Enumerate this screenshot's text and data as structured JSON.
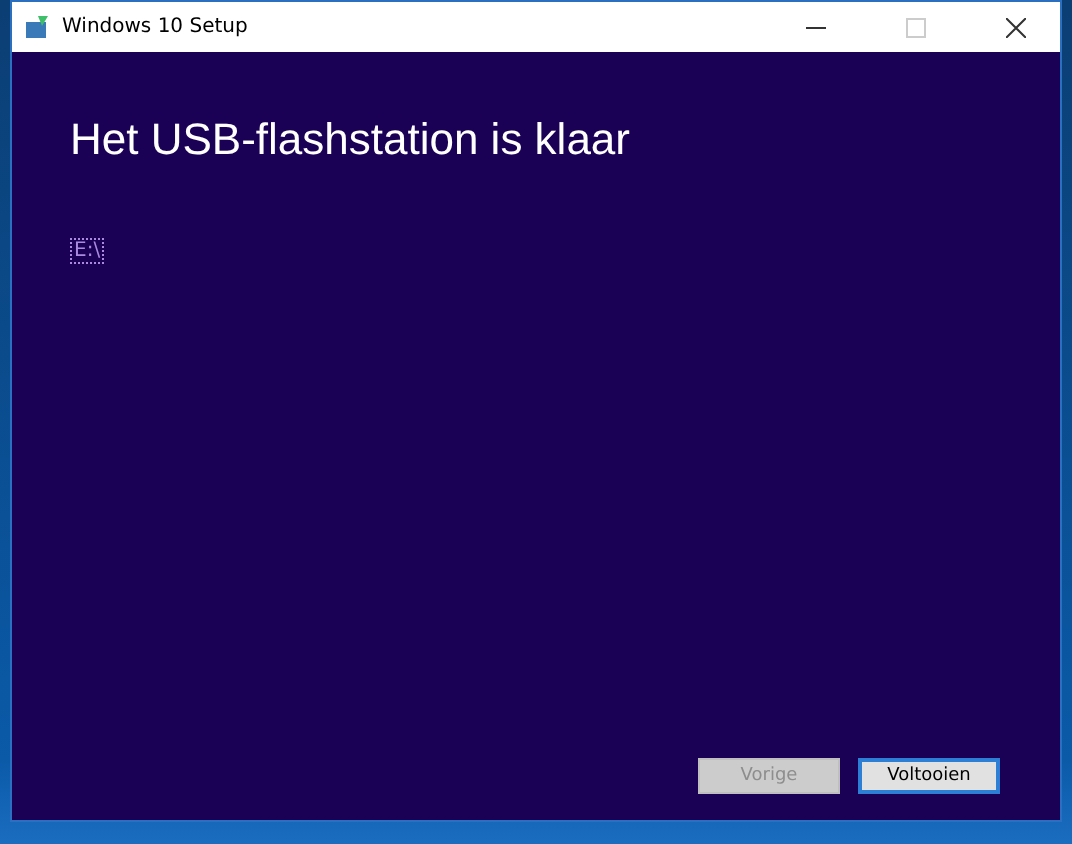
{
  "window": {
    "title": "Windows 10 Setup"
  },
  "heading": "Het USB-flashstation is klaar",
  "drive": {
    "label": "E:\\",
    "focused": true
  },
  "buttons": [
    {
      "label": "Vorige",
      "disabled": true,
      "default": false
    },
    {
      "label": "Voltooien",
      "disabled": false,
      "default": true
    }
  ]
}
